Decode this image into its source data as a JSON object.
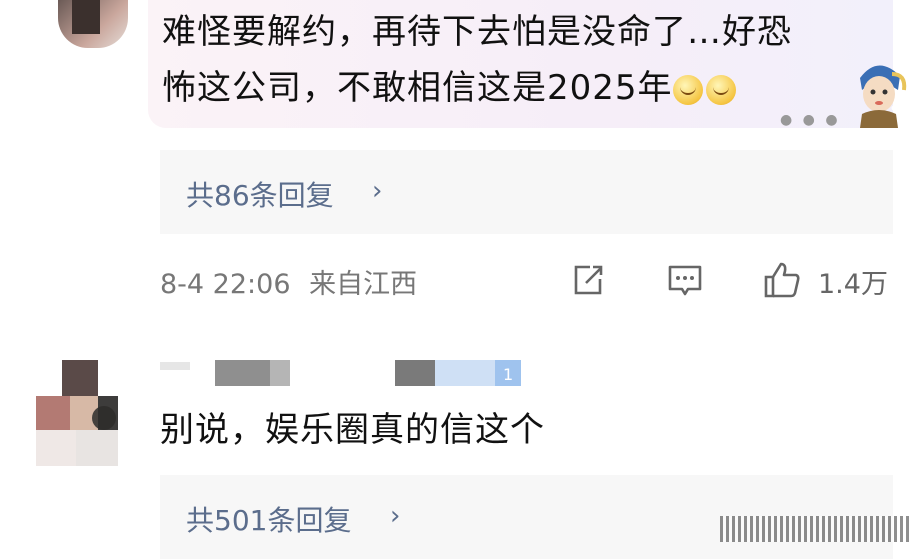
{
  "comment1": {
    "text_line1": "难怪要解约，再待下去怕是没命了…好恐",
    "text_line2": "怖这公司，不敢相信这是2025年",
    "emojis": [
      "grin-emoji",
      "grin-emoji"
    ],
    "replies_label": "共86条回复",
    "chevron": "›",
    "timestamp": "8-4 22:06",
    "location": "来自江西",
    "like_count": "1.4万"
  },
  "comment2": {
    "badge": "1",
    "text": "别说，娱乐圈真的信这个",
    "replies_label": "共501条回复",
    "chevron": "›"
  },
  "colors": {
    "link": "#5b6d8c",
    "meta": "#777777",
    "reply_bg": "#f7f7f7"
  }
}
